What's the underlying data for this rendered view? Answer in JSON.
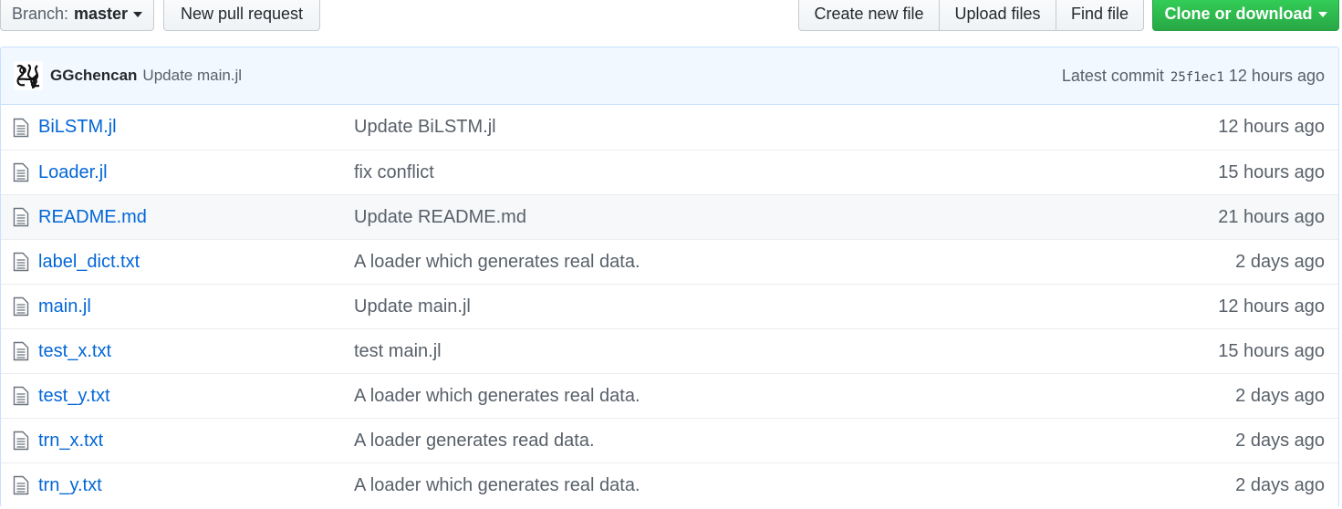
{
  "toolbar": {
    "branch_label": "Branch:",
    "branch_value": "master",
    "new_pr": "New pull request",
    "create_file": "Create new file",
    "upload_files": "Upload files",
    "find_file": "Find file",
    "clone": "Clone or download"
  },
  "commit": {
    "author": "GGchencan",
    "message": "Update main.jl",
    "latest_label": "Latest commit",
    "sha": "25f1ec1",
    "age": "12 hours ago"
  },
  "files": [
    {
      "name": "BiLSTM.jl",
      "message": "Update BiLSTM.jl",
      "age": "12 hours ago"
    },
    {
      "name": "Loader.jl",
      "message": "fix conflict",
      "age": "15 hours ago"
    },
    {
      "name": "README.md",
      "message": "Update README.md",
      "age": "21 hours ago"
    },
    {
      "name": "label_dict.txt",
      "message": "A loader which generates real data.",
      "age": "2 days ago"
    },
    {
      "name": "main.jl",
      "message": "Update main.jl",
      "age": "12 hours ago"
    },
    {
      "name": "test_x.txt",
      "message": "test main.jl",
      "age": "15 hours ago"
    },
    {
      "name": "test_y.txt",
      "message": "A loader which generates real data.",
      "age": "2 days ago"
    },
    {
      "name": "trn_x.txt",
      "message": "A loader generates read data.",
      "age": "2 days ago"
    },
    {
      "name": "trn_y.txt",
      "message": "A loader which generates real data.",
      "age": "2 days ago"
    }
  ],
  "colors": {
    "link": "#0366d6",
    "muted": "#586069",
    "green": "#28a745",
    "commit_bg": "#f1f8ff",
    "highlight_row": "#f6f8fa"
  },
  "icons": {
    "file": "file-text-icon",
    "caret": "caret-down-icon",
    "avatar": "avatar"
  }
}
